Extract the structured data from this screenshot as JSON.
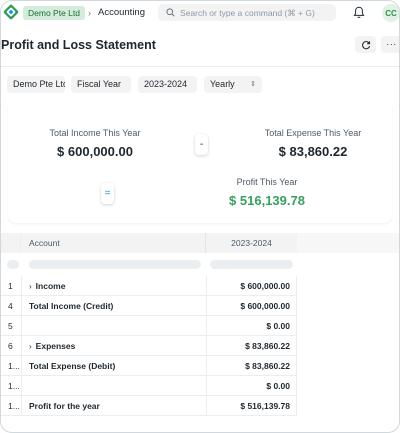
{
  "navbar": {
    "company": "Demo Pte Ltd",
    "breadcrumb_sep": "›",
    "breadcrumb": "Accounting",
    "search_placeholder": "Search or type a command (⌘ + G)",
    "avatar_initials": "CC"
  },
  "page": {
    "title": "Profit and Loss Statement",
    "more_label": "···"
  },
  "filters": {
    "company": "Demo Pte Ltd",
    "filter_based_on": "Fiscal Year",
    "period": "2023-2024",
    "periodicity": "Yearly",
    "periodicity_caret": "⇕"
  },
  "summary": {
    "income_label": "Total Income This Year",
    "income_value": "$ 600,000.00",
    "expense_label": "Total Expense This Year",
    "expense_value": "$ 83,860.22",
    "minus_op": "-",
    "equal_op": "=",
    "profit_label": "Profit This Year",
    "profit_value": "$ 516,139.78"
  },
  "table": {
    "headers": {
      "account": "Account",
      "period": "2023-2024"
    },
    "rows": [
      {
        "num": "1",
        "account": "Income",
        "value": "$ 600,000.00",
        "chevron": "›"
      },
      {
        "num": "4",
        "account": "Total Income (Credit)",
        "value": "$ 600,000.00"
      },
      {
        "num": "5",
        "account": "",
        "value": "$ 0.00"
      },
      {
        "num": "6",
        "account": "Expenses",
        "value": "$ 83,860.22",
        "chevron": "›"
      },
      {
        "num": "1...",
        "account": "Total Expense (Debit)",
        "value": "$ 83,860.22"
      },
      {
        "num": "1...",
        "account": "",
        "value": "$ 0.00"
      },
      {
        "num": "1...",
        "account": "Profit for the year",
        "value": "$ 516,139.78"
      }
    ]
  },
  "colors": {
    "profit_green": "#36a15f",
    "badge_bg": "#d4edda",
    "equal_blue": "#2490ef"
  }
}
